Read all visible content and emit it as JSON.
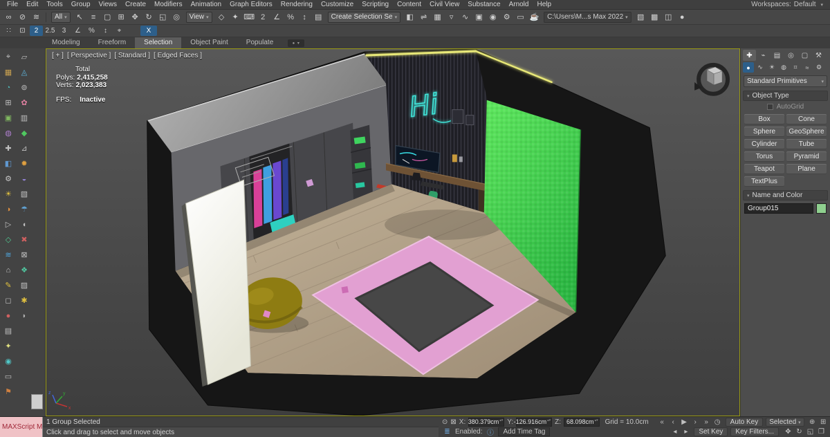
{
  "menubar": {
    "items": [
      "File",
      "Edit",
      "Tools",
      "Group",
      "Views",
      "Create",
      "Modifiers",
      "Animation",
      "Graph Editors",
      "Rendering",
      "Customize",
      "Scripting",
      "Content",
      "Civil View",
      "Substance",
      "Arnold",
      "Help"
    ],
    "workspaces_label": "Workspaces:",
    "workspace_value": "Default"
  },
  "toolbar_main": {
    "selection_filter_value": "All",
    "coord_system_value": "View",
    "selection_set_value": "Create Selection Se",
    "project_path_value": "C:\\Users\\M...s Max 2022",
    "icons_a": [
      {
        "g": "∞",
        "n": "select-and-link-icon"
      },
      {
        "g": "⊘",
        "n": "unlink-selection-icon"
      },
      {
        "g": "≋",
        "n": "bind-to-spacewarp-icon"
      }
    ],
    "icons_b": [
      {
        "g": "↖",
        "n": "select-object-icon"
      },
      {
        "g": "≡",
        "n": "select-by-name-icon"
      },
      {
        "g": "▢",
        "n": "rectangular-selection-region-icon"
      },
      {
        "g": "⊞",
        "n": "window-crossing-icon"
      }
    ],
    "icons_c": [
      {
        "g": "✥",
        "n": "select-and-move-icon"
      },
      {
        "g": "↻",
        "n": "select-and-rotate-icon"
      },
      {
        "g": "◱",
        "n": "select-and-scale-icon"
      },
      {
        "g": "◎",
        "n": "select-and-place-icon"
      }
    ],
    "icons_d": [
      {
        "g": "◇",
        "n": "use-pivot-point-icon"
      },
      {
        "g": "✦",
        "n": "select-and-manipulate-icon"
      },
      {
        "g": "⌨",
        "n": "keyboard-shortcut-override-icon"
      }
    ],
    "icons_e": [
      {
        "g": "2",
        "n": "snaps-toggle-icon"
      },
      {
        "g": "∠",
        "n": "angle-snap-icon"
      },
      {
        "g": "%",
        "n": "percent-snap-icon"
      },
      {
        "g": "↕",
        "n": "spinner-snap-icon"
      }
    ],
    "icons_f": [
      {
        "g": "▤",
        "n": "named-selection-sets-icon"
      }
    ],
    "icons_g": [
      {
        "g": "◧",
        "n": "mirror-icon"
      },
      {
        "g": "⇌",
        "n": "align-icon"
      },
      {
        "g": "▦",
        "n": "layer-manager-icon"
      },
      {
        "g": "▿",
        "n": "ribbon-toggle-icon"
      },
      {
        "g": "∿",
        "n": "curve-editor-icon"
      },
      {
        "g": "▣",
        "n": "schematic-view-icon"
      },
      {
        "g": "◉",
        "n": "material-editor-icon"
      },
      {
        "g": "⚙",
        "n": "render-setup-icon"
      },
      {
        "g": "▭",
        "n": "rendered-frame-icon"
      },
      {
        "g": "☕",
        "n": "render-production-icon"
      }
    ],
    "icons_h": [
      {
        "g": "▧",
        "n": "render-iterative-icon"
      },
      {
        "g": "▩",
        "n": "activeshade-icon"
      },
      {
        "g": "◫",
        "n": "render-in-cloud-icon"
      },
      {
        "g": "●",
        "n": "render-last-icon"
      }
    ]
  },
  "toolbar_snap": {
    "icons": [
      {
        "g": "∷",
        "n": "grid-settings-icon"
      },
      {
        "g": "⊡",
        "n": "working-pivot-icon"
      },
      {
        "g": "2",
        "n": "snap-2d-icon",
        "cls": "active"
      },
      {
        "g": "2.5",
        "n": "snap-25d-icon"
      },
      {
        "g": "3",
        "n": "snap-3d-icon"
      },
      {
        "g": "∠",
        "n": "angle-snap-toggle-icon"
      },
      {
        "g": "%",
        "n": "percent-snap-toggle-icon"
      },
      {
        "g": "↕",
        "n": "spinner-snap-toggle-icon"
      },
      {
        "g": "⌖",
        "n": "snap-settings-icon"
      }
    ],
    "axis_button": "X"
  },
  "ribbon": {
    "tabs": [
      {
        "label": "Modeling"
      },
      {
        "label": "Freeform"
      },
      {
        "label": "Selection",
        "cls": "active"
      },
      {
        "label": "Object Paint"
      },
      {
        "label": "Populate"
      }
    ]
  },
  "left_rail": {
    "col1": [
      {
        "g": "⌖",
        "c": "#c0c0c0"
      },
      {
        "g": "▦",
        "c": "#c8a050"
      },
      {
        "g": "◔",
        "c": "#50b8b8"
      },
      {
        "g": "⊞",
        "c": "#c0c0c0"
      },
      {
        "g": "▣",
        "c": "#80b860"
      },
      {
        "g": "◍",
        "c": "#b080d0"
      },
      {
        "g": "✚",
        "c": "#c0c0c0"
      },
      {
        "g": "◧",
        "c": "#6098d0"
      },
      {
        "g": "⚙",
        "c": "#c8c8c8"
      },
      {
        "g": "☀",
        "c": "#e0c040"
      },
      {
        "g": "◑",
        "c": "#e09040"
      },
      {
        "g": "▷",
        "c": "#c0c0c0"
      },
      {
        "g": "◇",
        "c": "#50c890"
      },
      {
        "g": "≋",
        "c": "#50a8e0"
      },
      {
        "g": "⌂",
        "c": "#c8c8c8"
      },
      {
        "g": "✎",
        "c": "#e0c040"
      },
      {
        "g": "◻",
        "c": "#c0c0c0"
      },
      {
        "g": "●",
        "c": "#d06060"
      },
      {
        "g": "▤",
        "c": "#c0c0c0"
      },
      {
        "g": "✦",
        "c": "#e0e080"
      },
      {
        "g": "◉",
        "c": "#50c8c8"
      },
      {
        "g": "▭",
        "c": "#c0c0c0"
      },
      {
        "g": "⚑",
        "c": "#d08040"
      }
    ],
    "col2": [
      {
        "g": "▱",
        "c": "#c0c0c0"
      },
      {
        "g": "◬",
        "c": "#60b8e0"
      },
      {
        "g": "⊚",
        "c": "#c0c0c0"
      },
      {
        "g": "✿",
        "c": "#e080a0"
      },
      {
        "g": "▥",
        "c": "#c0c0c0"
      },
      {
        "g": "◆",
        "c": "#50c860"
      },
      {
        "g": "⊿",
        "c": "#c0c0c0"
      },
      {
        "g": "✹",
        "c": "#e0a040"
      },
      {
        "g": "◒",
        "c": "#9080d0"
      },
      {
        "g": "▧",
        "c": "#c0c0c0"
      },
      {
        "g": "☂",
        "c": "#60a0d0"
      },
      {
        "g": "◖",
        "c": "#c0c0c0"
      },
      {
        "g": "✖",
        "c": "#d06060"
      },
      {
        "g": "⊠",
        "c": "#c0c0c0"
      },
      {
        "g": "❖",
        "c": "#50c8a0"
      },
      {
        "g": "▨",
        "c": "#c0c0c0"
      },
      {
        "g": "✱",
        "c": "#e0c040"
      },
      {
        "g": "◗",
        "c": "#b0b0b0"
      }
    ]
  },
  "viewport": {
    "menus": [
      "[ + ]",
      "[ Perspective ]",
      "[ Standard ]",
      "[ Edged Faces ]"
    ],
    "stats": {
      "total_label": "Total",
      "polys_label": "Polys:",
      "polys_value": "2,415,258",
      "verts_label": "Verts:",
      "verts_value": "2,023,383",
      "fps_label": "FPS:",
      "fps_value": "Inactive"
    },
    "neon_text": "Hi",
    "scene_colors": {
      "green_wall": "#44d94c",
      "rug_pink": "#e2a0d2",
      "rug_gray": "#474747",
      "bean_bag": "#8e7c12",
      "floor": "#b5a48c",
      "neon": "#40e8dc",
      "door_white": "#fbfbf4"
    }
  },
  "command_panel": {
    "tabs": [
      {
        "g": "✚",
        "n": "create-tab",
        "cls": "active"
      },
      {
        "g": "⌁",
        "n": "modify-tab"
      },
      {
        "g": "▤",
        "n": "hierarchy-tab"
      },
      {
        "g": "◎",
        "n": "motion-tab"
      },
      {
        "g": "▢",
        "n": "display-tab"
      },
      {
        "g": "⚒",
        "n": "utilities-tab"
      }
    ],
    "categories": [
      {
        "g": "●",
        "n": "geometry-category",
        "cls": "active"
      },
      {
        "g": "∿",
        "n": "shapes-category"
      },
      {
        "g": "☀",
        "n": "lights-category"
      },
      {
        "g": "◍",
        "n": "cameras-category"
      },
      {
        "g": "⌗",
        "n": "helpers-category"
      },
      {
        "g": "≈",
        "n": "spacewarps-category"
      },
      {
        "g": "⚙",
        "n": "systems-category"
      }
    ],
    "subcategory_value": "Standard Primitives",
    "object_type_header": "Object Type",
    "autogrid_label": "AutoGrid",
    "object_buttons": [
      "Box",
      "Cone",
      "Sphere",
      "GeoSphere",
      "Cylinder",
      "Tube",
      "Torus",
      "Pyramid",
      "Teapot",
      "Plane",
      "TextPlus"
    ],
    "name_color_header": "Name and Color",
    "object_name_value": "Group015",
    "object_color": "#8fd08f"
  },
  "statusbar": {
    "maxscript_label": "MAXScript Mi",
    "selection_status": "1 Group Selected",
    "prompt": "Click and drag to select and move objects",
    "x_label": "X:",
    "x_value": "380.379cm",
    "y_label": "Y:",
    "y_value": "-126.916cm",
    "z_label": "Z:",
    "z_value": "68.098cm",
    "grid_label": "Grid = 10.0cm",
    "enabled_label": "Enabled:",
    "info_glyph": "ⓘ",
    "enabled_toggle_glyph": "≣",
    "isolate_glyph": "⊙",
    "lock_glyph": "⊠",
    "add_time_tag": "Add Time Tag",
    "auto_key_label": "Auto Key",
    "selected_value": "Selected",
    "set_key_label": "Set Key",
    "key_filters_label": "Key Filters...",
    "transport": [
      {
        "g": "«",
        "n": "go-to-start-icon"
      },
      {
        "g": "‹",
        "n": "previous-frame-icon"
      },
      {
        "g": "▶",
        "n": "play-icon"
      },
      {
        "g": "›",
        "n": "next-frame-icon"
      },
      {
        "g": "»",
        "n": "go-to-end-icon"
      },
      {
        "g": "◷",
        "n": "time-configuration-icon"
      }
    ],
    "key_steps": [
      {
        "g": "◂",
        "n": "previous-key-icon"
      },
      {
        "g": "▸",
        "n": "next-key-icon"
      }
    ],
    "nav1": [
      {
        "g": "⊕",
        "n": "zoom-icon"
      },
      {
        "g": "⊞",
        "n": "zoom-all-icon"
      },
      {
        "g": "❏",
        "n": "zoom-extents-icon"
      },
      {
        "g": "▭",
        "n": "zoom-region-icon"
      }
    ],
    "nav2": [
      {
        "g": "✥",
        "n": "pan-icon"
      },
      {
        "g": "↻",
        "n": "orbit-icon"
      },
      {
        "g": "◱",
        "n": "field-of-view-icon"
      },
      {
        "g": "❐",
        "n": "maximize-viewport-icon"
      }
    ]
  }
}
